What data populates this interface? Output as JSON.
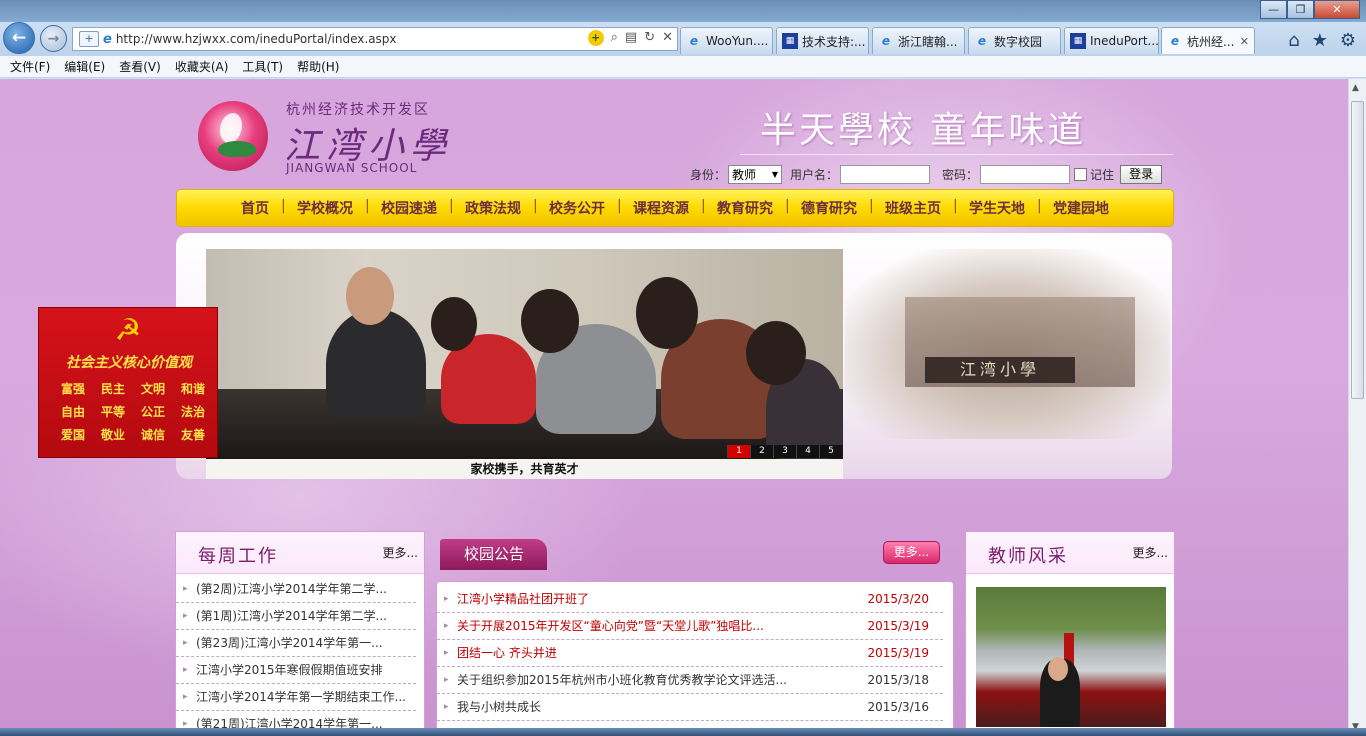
{
  "browser": {
    "url": "http://www.hzjwxx.com/ineduPortal/index.aspx",
    "tabs": [
      {
        "label": "WooYun....",
        "icon": "ie-icon"
      },
      {
        "label": "技术支持:...",
        "icon": "app-icon"
      },
      {
        "label": "浙江瞎翰...",
        "icon": "ie-icon"
      },
      {
        "label": "数字校园",
        "icon": "ie-icon"
      },
      {
        "label": "IneduPort...",
        "icon": "app-icon"
      },
      {
        "label": "杭州经...",
        "icon": "ie-icon",
        "active": true
      }
    ],
    "tab_close": "✕",
    "window_controls": {
      "minimize": "—",
      "maximize": "❐",
      "close": "✕"
    },
    "command_icons": [
      "home-icon",
      "favorites-star-icon",
      "tools-gear-icon"
    ]
  },
  "menubar": [
    "文件(F)",
    "编辑(E)",
    "查看(V)",
    "收藏夹(A)",
    "工具(T)",
    "帮助(H)"
  ],
  "header": {
    "district": "杭州经济技术开发区",
    "school_cn": "江湾小學",
    "school_en": "JIANGWAN SCHOOL",
    "slogan": "半天學校  童年味道"
  },
  "login": {
    "role_label": "身份：",
    "role_value": "教师",
    "username_label": "用户名：",
    "password_label": "密码：",
    "remember_label": "记住",
    "submit_label": "登录"
  },
  "nav": [
    "首页",
    "学校概况",
    "校园速递",
    "政策法规",
    "校务公开",
    "课程资源",
    "教育研究",
    "德育研究",
    "班级主页",
    "学生天地",
    "党建园地"
  ],
  "slideshow": {
    "caption": "家校携手，共育英才",
    "pages": [
      "1",
      "2",
      "3",
      "4",
      "5"
    ],
    "active_page": "1",
    "side_plaque": "江湾小學"
  },
  "party_banner": {
    "title": "社会主义核心价值观",
    "values": [
      "富强",
      "民主",
      "文明",
      "和谐",
      "自由",
      "平等",
      "公正",
      "法治",
      "爱国",
      "敬业",
      "诚信",
      "友善"
    ]
  },
  "weekly": {
    "title": "每周工作",
    "more": "更多...",
    "items": [
      "(第2周)江湾小学2014学年第二学...",
      "(第1周)江湾小学2014学年第二学...",
      "(第23周)江湾小学2014学年第一...",
      "江湾小学2015年寒假假期值班安排",
      "江湾小学2014学年第一学期结束工作...",
      "(第21周)江湾小学2014学年第一..."
    ]
  },
  "notice": {
    "title": "校园公告",
    "more": "更多...",
    "items": [
      {
        "text": "江湾小学精品社团开班了",
        "date": "2015/3/20",
        "hot": true
      },
      {
        "text": "关于开展2015年开发区“童心向党”暨“天堂儿歌”独唱比...",
        "date": "2015/3/19",
        "hot": true
      },
      {
        "text": "团结一心 齐头并进",
        "date": "2015/3/19",
        "hot": true
      },
      {
        "text": "关于组织参加2015年杭州市小班化教育优秀教学论文评选活...",
        "date": "2015/3/18",
        "hot": false
      },
      {
        "text": "我与小树共成长",
        "date": "2015/3/16",
        "hot": false
      }
    ]
  },
  "teachers": {
    "title": "教师风采",
    "more": "更多..."
  }
}
